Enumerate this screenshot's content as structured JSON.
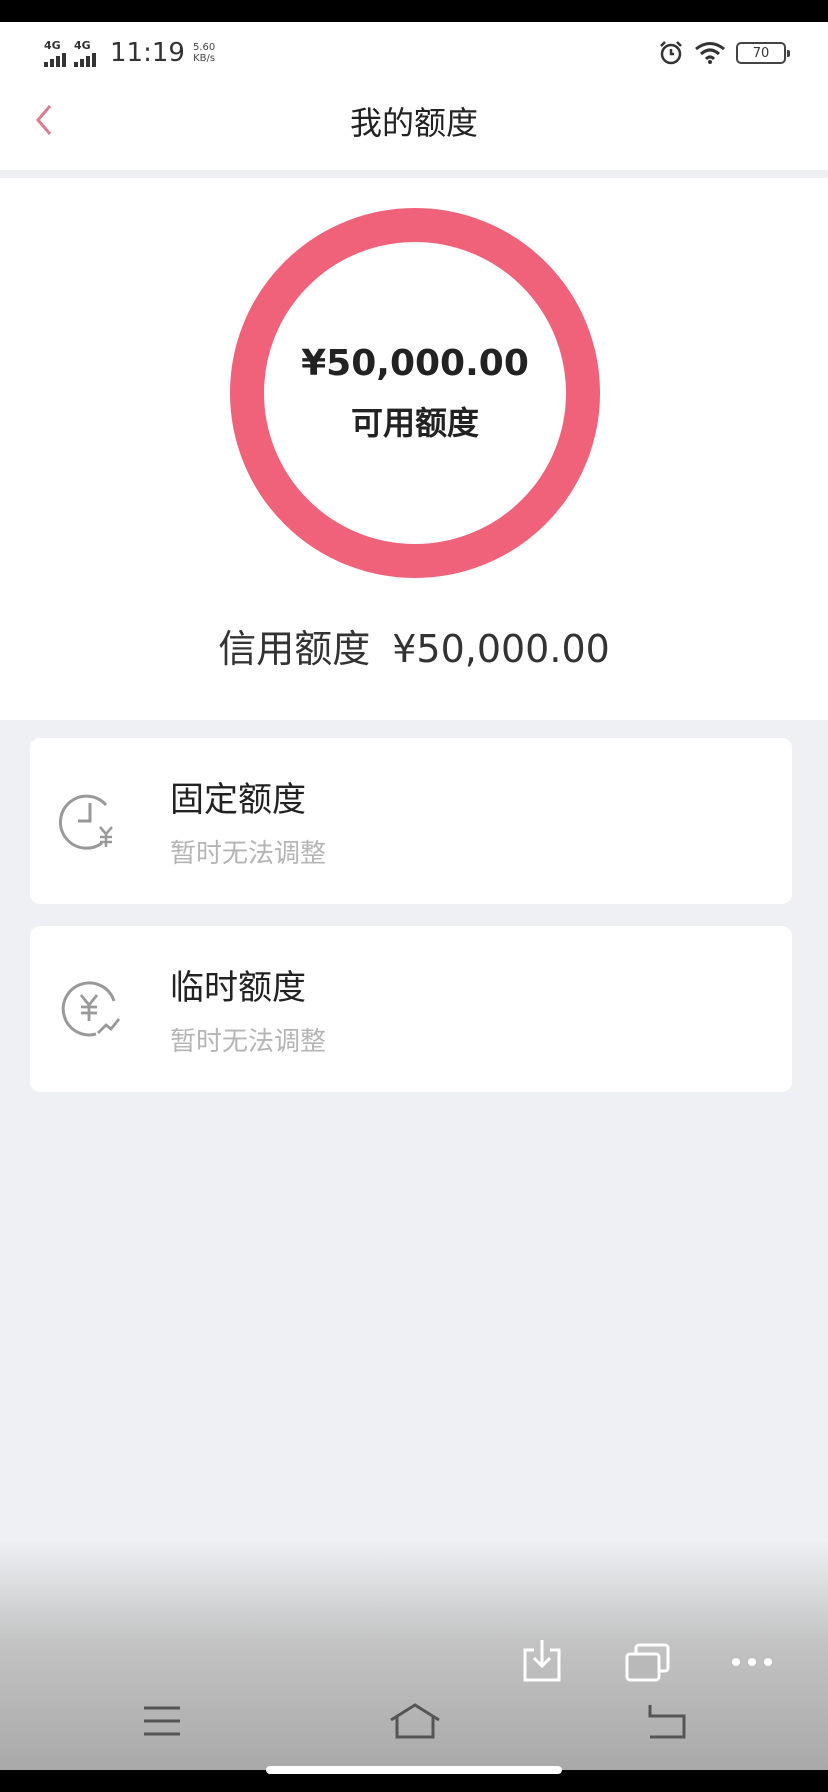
{
  "status_bar": {
    "network_1": "4G",
    "network_2": "4G",
    "time": "11:19",
    "speed_value": "5.60",
    "speed_unit": "KB/s",
    "battery": "70"
  },
  "header": {
    "title": "我的额度",
    "back_icon": "chevron-left-icon"
  },
  "hero": {
    "available_amount": "¥50,000.00",
    "available_label": "可用额度",
    "credit_label": "信用额度",
    "credit_amount": "¥50,000.00",
    "ring_color": "#f0627a"
  },
  "cards": [
    {
      "title": "固定额度",
      "subtitle": "暂时无法调整",
      "icon": "clock-yen-icon"
    },
    {
      "title": "临时额度",
      "subtitle": "暂时无法调整",
      "icon": "yen-trend-icon"
    }
  ],
  "browser_toolbar": {
    "icons": [
      "download-icon",
      "windows-icon",
      "more-icon",
      "menu-icon",
      "home-icon",
      "back-icon"
    ]
  }
}
